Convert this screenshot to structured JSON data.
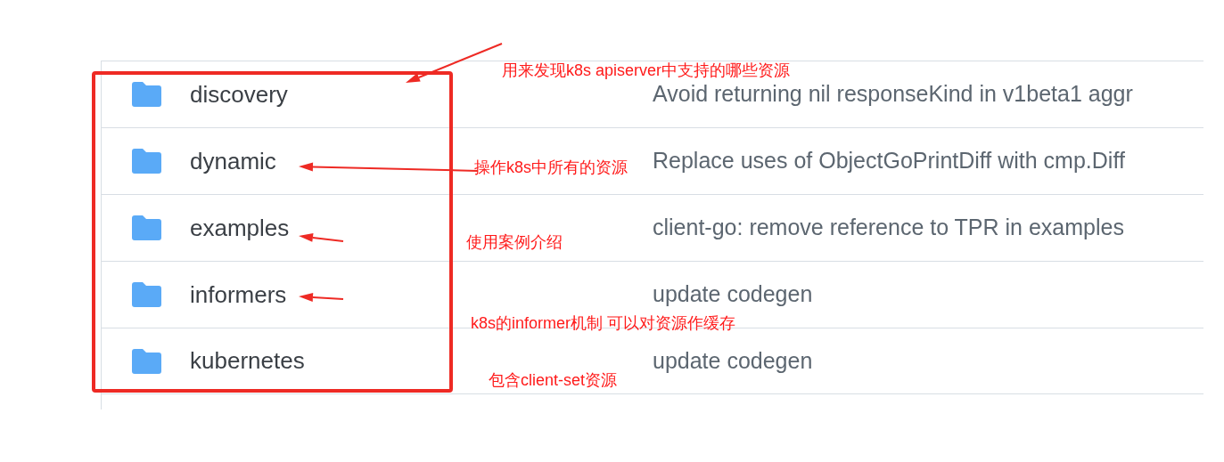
{
  "files": [
    {
      "kind": "folder",
      "name": "discovery",
      "message": "Avoid returning nil responseKind in v1beta1 aggr"
    },
    {
      "kind": "folder",
      "name": "dynamic",
      "message": "Replace uses of ObjectGoPrintDiff with cmp.Diff"
    },
    {
      "kind": "folder",
      "name": "examples",
      "message": "client-go: remove reference to TPR in examples"
    },
    {
      "kind": "folder",
      "name": "informers",
      "message": "update codegen"
    },
    {
      "kind": "folder",
      "name": "kubernetes",
      "message": "update codegen"
    }
  ],
  "annotations": [
    {
      "text": "用来发现k8s apiserver中支持的哪些资源"
    },
    {
      "text": "操作k8s中所有的资源"
    },
    {
      "text": "使用案例介绍"
    },
    {
      "text": "k8s的informer机制 可以对资源作缓存"
    },
    {
      "text": "包含client-set资源"
    }
  ]
}
